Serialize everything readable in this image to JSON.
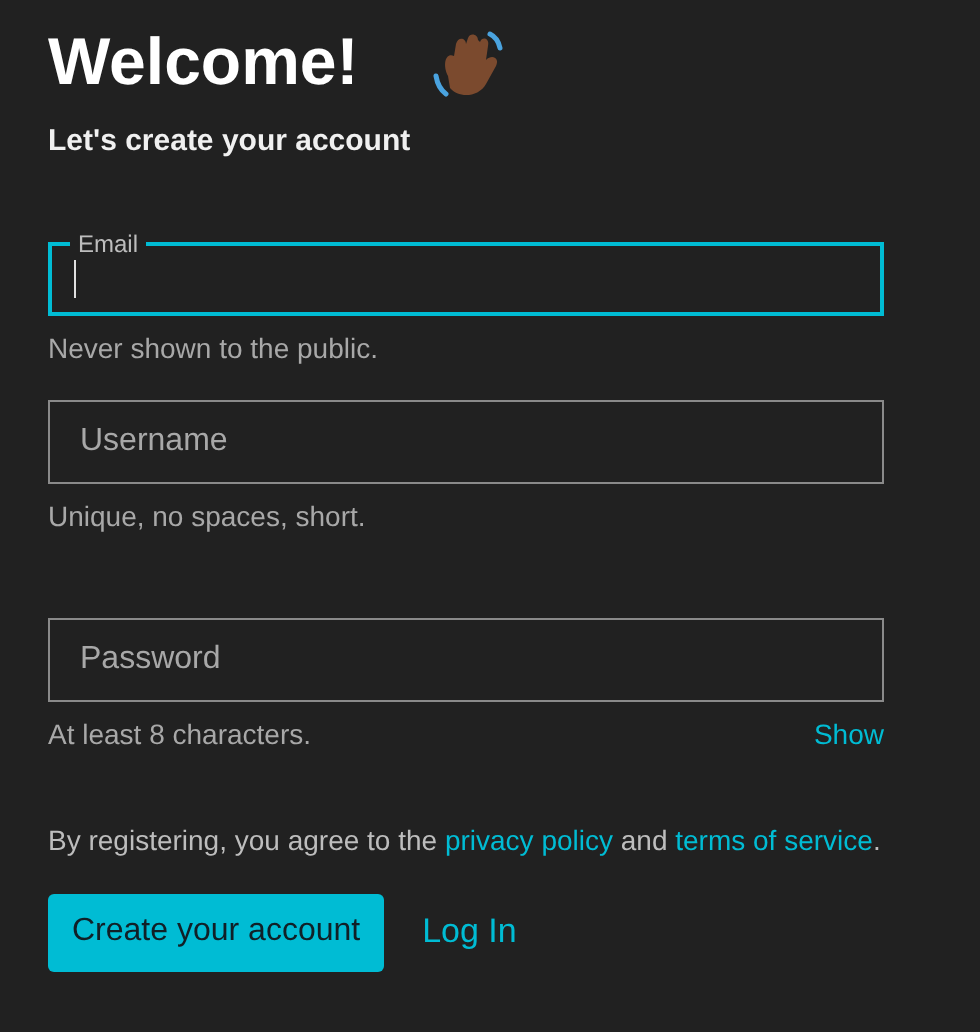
{
  "title": "Welcome!",
  "subtitle": "Let's create your account",
  "fields": [
    {
      "label": "Email",
      "helper": "Never shown to the public.",
      "focused": true
    },
    {
      "label": "Username",
      "helper": "Unique, no spaces, short.",
      "focused": false
    },
    {
      "label": "Password",
      "helper": "At least 8 characters.",
      "focused": false,
      "action": "Show"
    }
  ],
  "agreement": [
    {
      "kind": "text",
      "text": "By registering, you agree to the "
    },
    {
      "kind": "link",
      "text": "privacy policy"
    },
    {
      "kind": "text",
      "text": " and "
    },
    {
      "kind": "link",
      "text": "terms of service"
    },
    {
      "kind": "text",
      "text": "."
    }
  ],
  "primary_button": "Create your account",
  "login_link": "Log In"
}
